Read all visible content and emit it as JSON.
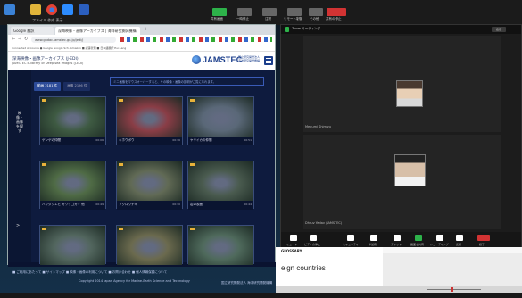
{
  "desktop": {
    "taskbar_items": [
      "Docker",
      "Explorer",
      "Chrome",
      "Zoom",
      "Word",
      "PowerPoint",
      "Excel"
    ],
    "zoom_controls": [
      {
        "label": "共有画面",
        "color": "#2db24a"
      },
      {
        "label": "一時停止",
        "color": "#666666"
      },
      {
        "label": "注釈",
        "color": "#666666"
      },
      {
        "label": "リモート制御",
        "color": "#666666"
      },
      {
        "label": "その他",
        "color": "#666666"
      },
      {
        "label": "共有の停止",
        "color": "#d23333"
      }
    ]
  },
  "browser": {
    "tab_label": "Google 翻訳",
    "active_tab_label": "深海映像・画像アーカイブス | 海洋研究開発機構",
    "address": "www.godac.jamstec.go.jp/jedi/j",
    "bookmarks": "Connected Accounts   ● Google   Google Sch.   Amazon   ■ 記事管理   ■ 日本語翻訳   Eur.Lang",
    "site_title": "深海映像・画像アーカイブス (J-EDI)",
    "site_subtitle": "JAMSTEC E-library of Deep-sea Images (J-EDI)",
    "logo": "JAMSTEC",
    "logo_sub": "国立研究開発法人\n海洋研究開発機構",
    "side_label": "映像・画像を探す",
    "tabs": [
      {
        "label": "動画 2181 件"
      },
      {
        "label": "画像 2196 件"
      }
    ],
    "notice": "ミニ画像をマウスオーバーすると、その映像・画像の説明がご覧になれます。",
    "thumbnails": [
      {
        "caption": "ゲンゲの仲間",
        "count": "00:06",
        "color": "#3e5a42"
      },
      {
        "caption": "キホウボウ",
        "count": "00:36",
        "color": "#8a3d46"
      },
      {
        "caption": "ヤリイカの仲間",
        "count": "00:51",
        "color": "#5a6878"
      },
      {
        "caption": "ハリダシエビ カワリゴカイ 他",
        "count": "00:49",
        "color": "#4f6b45"
      },
      {
        "caption": "フクロウナギ",
        "count": "00:30",
        "color": "#616a55"
      },
      {
        "caption": "岩の表面",
        "count": "00:44",
        "color": "#4a5b4f"
      },
      {
        "caption": "",
        "count": "",
        "color": "#52665e"
      },
      {
        "caption": "",
        "count": "",
        "color": "#6b6a4e"
      },
      {
        "caption": "",
        "count": "",
        "color": "#4f6a5c"
      }
    ],
    "footer_links": "■ ご利用にあたって   ■ サイトマップ   ■ 映像・画像の利用について   ■ お問い合わせ   ■ 個人情報保護について",
    "copyright": "Copyright 2014 Japan Agency for Marine-Earth Science and Technology",
    "footer_org": "国立研究開発法人 海洋研究開発機構"
  },
  "zoom": {
    "window_title": "Zoom ミーティング",
    "view_label": "表示",
    "participants": [
      {
        "name": "Megumi Shimizu"
      },
      {
        "name": "Dhruv Yadav (JAMSTEC)"
      }
    ],
    "toolbar": [
      {
        "label": "ミュート",
        "color": "#ffffff"
      },
      {
        "label": "ビデオの停止",
        "color": "#ffffff"
      },
      {
        "label": "セキュリティ",
        "color": "#ffffff"
      },
      {
        "label": "参加者",
        "color": "#ffffff"
      },
      {
        "label": "チャット",
        "color": "#ffffff"
      },
      {
        "label": "画面を共有",
        "color": "#2db24a"
      },
      {
        "label": "レコーディング",
        "color": "#ffffff"
      },
      {
        "label": "反応",
        "color": "#ffffff"
      },
      {
        "label": "終了",
        "color": "#d23333"
      }
    ]
  },
  "background_doc": {
    "heading": "GLOSSARY",
    "text": "eign countries"
  }
}
